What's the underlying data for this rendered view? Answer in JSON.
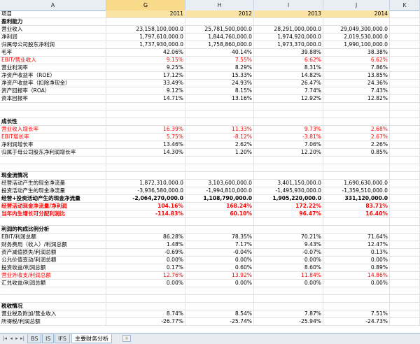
{
  "columns": {
    "a": "A",
    "g": "G",
    "h": "H",
    "i": "I",
    "j": "J",
    "k": "K"
  },
  "rows": [
    {
      "label": "项目",
      "g": "2011",
      "h": "2012",
      "i": "2013",
      "j": "2014",
      "style": "year"
    },
    {
      "label": "盈利能力",
      "style": "section"
    },
    {
      "label": "营业收入",
      "g": "23,158,100,000.0",
      "h": "25,781,500,000.0",
      "i": "28,291,000,000.0",
      "j": "29,049,300,000.0"
    },
    {
      "label": "净利润",
      "g": "1,797,610,000.0",
      "h": "1,844,760,000.0",
      "i": "1,974,920,000.0",
      "j": "2,019,530,000.0"
    },
    {
      "label": "归属母公司股东净利润",
      "g": "1,737,930,000.0",
      "h": "1,758,860,000.0",
      "i": "1,973,370,000.0",
      "j": "1,990,100,000.0"
    },
    {
      "label": "毛率",
      "g": "42.06%",
      "h": "40.14%",
      "i": "39.88%",
      "j": "38.38%"
    },
    {
      "label": "EBIT/营业收入",
      "g": "9.15%",
      "h": "7.55%",
      "i": "6.62%",
      "j": "6.62%",
      "style": "red"
    },
    {
      "label": "营业利润率",
      "g": "9.25%",
      "h": "8.29%",
      "i": "8.31%",
      "j": "7.86%"
    },
    {
      "label": "净资产收益率（ROE）",
      "g": "17.12%",
      "h": "15.33%",
      "i": "14.82%",
      "j": "13.85%"
    },
    {
      "label": "净资产收益率（扣除净现金）",
      "g": "33.49%",
      "h": "24.93%",
      "i": "26.47%",
      "j": "24.36%"
    },
    {
      "label": "资产回报率（ROA）",
      "g": "9.12%",
      "h": "8.15%",
      "i": "7.74%",
      "j": "7.43%"
    },
    {
      "label": "资本回报率",
      "g": "14.71%",
      "h": "13.16%",
      "i": "12.92%",
      "j": "12.82%"
    },
    {
      "label": ""
    },
    {
      "label": ""
    },
    {
      "label": "成长性",
      "style": "section"
    },
    {
      "label": "营业收入增长率",
      "g": "16.39%",
      "h": "11.33%",
      "i": "9.73%",
      "j": "2.68%",
      "style": "red"
    },
    {
      "label": "EBIT增长率",
      "g": "5.75%",
      "h": "-8.12%",
      "i": "-3.81%",
      "j": "2.67%",
      "style": "red"
    },
    {
      "label": "净利润增长率",
      "g": "13.46%",
      "h": "2.62%",
      "i": "7.06%",
      "j": "2.26%"
    },
    {
      "label": "归属于母公司股东净利润增长率",
      "g": "14.30%",
      "h": "1.20%",
      "i": "12.20%",
      "j": "0.85%"
    },
    {
      "label": ""
    },
    {
      "label": ""
    },
    {
      "label": "现金流情况",
      "style": "section"
    },
    {
      "label": "经营活动产生的现金净流量",
      "g": "1,872,310,000.0",
      "h": "3,103,600,000.0",
      "i": "3,401,150,000.0",
      "j": "1,690,630,000.0"
    },
    {
      "label": "投资活动产生的现金净流量",
      "g": "-3,936,580,000.0",
      "h": "-1,994,810,000.0",
      "i": "-1,495,930,000.0",
      "j": "-1,359,510,000.0"
    },
    {
      "label": "经营+投资活动产生的现金净流量",
      "g": "-2,064,270,000.0",
      "h": "1,108,790,000.0",
      "i": "1,905,220,000.0",
      "j": "331,120,000.0",
      "style": "bold"
    },
    {
      "label": "经营活动现金净流量/净利润",
      "g": "104.16%",
      "h": "168.24%",
      "i": "172.22%",
      "j": "83.71%",
      "style": "boldred"
    },
    {
      "label": "当年内生增长可分配利润比",
      "g": "-114.83%",
      "h": "60.10%",
      "i": "96.47%",
      "j": "16.40%",
      "style": "boldred"
    },
    {
      "label": ""
    },
    {
      "label": "利润的构成比例分析",
      "style": "section"
    },
    {
      "label": "EBIT/利润总额",
      "g": "86.28%",
      "h": "78.35%",
      "i": "70.21%",
      "j": "71.64%"
    },
    {
      "label": "财务费用（收入）/利润总额",
      "g": "1.48%",
      "h": "7.17%",
      "i": "9.43%",
      "j": "12.47%"
    },
    {
      "label": "资产减值损失/利润总额",
      "g": "-0.69%",
      "h": "-0.04%",
      "i": "-0.07%",
      "j": "0.13%"
    },
    {
      "label": "公允价值变动/利润总额",
      "g": "0.00%",
      "h": "0.00%",
      "i": "0.00%",
      "j": "0.00%"
    },
    {
      "label": "投资收益/利润总额",
      "g": "0.17%",
      "h": "0.60%",
      "i": "8.60%",
      "j": "0.89%"
    },
    {
      "label": "营业外收支/利润总额",
      "g": "12.76%",
      "h": "13.92%",
      "i": "11.84%",
      "j": "14.86%",
      "style": "red"
    },
    {
      "label": "汇兑收益/利润总额",
      "g": "0.00%",
      "h": "0.00%",
      "i": "0.00%",
      "j": "0.00%"
    },
    {
      "label": ""
    },
    {
      "label": ""
    },
    {
      "label": "税收情况",
      "style": "section"
    },
    {
      "label": "营业税及附加/营业收入",
      "g": "8.74%",
      "h": "8.54%",
      "i": "7.87%",
      "j": "7.51%"
    },
    {
      "label": "所得税/利润总额",
      "g": "-26.77%",
      "h": "-25.74%",
      "i": "-25.94%",
      "j": "-24.73%"
    }
  ],
  "tabs": [
    {
      "label": "BS",
      "active": false
    },
    {
      "label": "IS",
      "active": false
    },
    {
      "label": "IFS",
      "active": false
    },
    {
      "label": "主要财务分析",
      "active": true
    }
  ],
  "nav_icons": [
    "first-sheet-icon",
    "prev-sheet-icon",
    "next-sheet-icon",
    "last-sheet-icon"
  ]
}
